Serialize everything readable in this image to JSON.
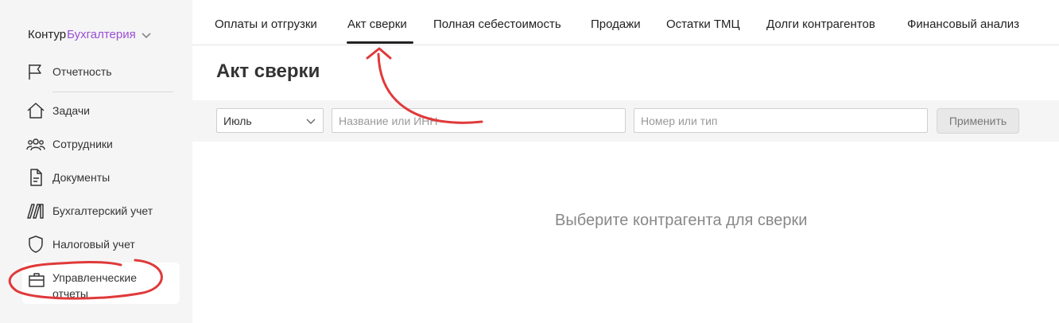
{
  "logo": {
    "brand": "Контур",
    "product": "Бухгалтерия"
  },
  "sidebar": {
    "items": [
      {
        "label": "Отчетность"
      },
      {
        "label": "Задачи"
      },
      {
        "label": "Сотрудники"
      },
      {
        "label": "Документы"
      },
      {
        "label": "Бухгалтерский учет"
      },
      {
        "label": "Налоговый учет"
      }
    ],
    "active_item": {
      "line1": "Управленческие",
      "line2": "отчеты"
    }
  },
  "tabs": [
    {
      "label": "Оплаты и отгрузки"
    },
    {
      "label": "Акт сверки",
      "active": true
    },
    {
      "label": "Полная себестоимость"
    },
    {
      "label": "Продажи"
    },
    {
      "label": "Остатки ТМЦ"
    },
    {
      "label": "Долги контрагентов"
    },
    {
      "label": "Финансовый анализ"
    }
  ],
  "page": {
    "title": "Акт сверки"
  },
  "filters": {
    "period_value": "Июль",
    "counterparty_placeholder": "Название или ИНН",
    "number_placeholder": "Номер или тип",
    "apply_label": "Применить"
  },
  "empty_state": "Выберите контрагента для сверки",
  "colors": {
    "brand_accent": "#9a4fd6",
    "annotation": "#e03a3a"
  }
}
